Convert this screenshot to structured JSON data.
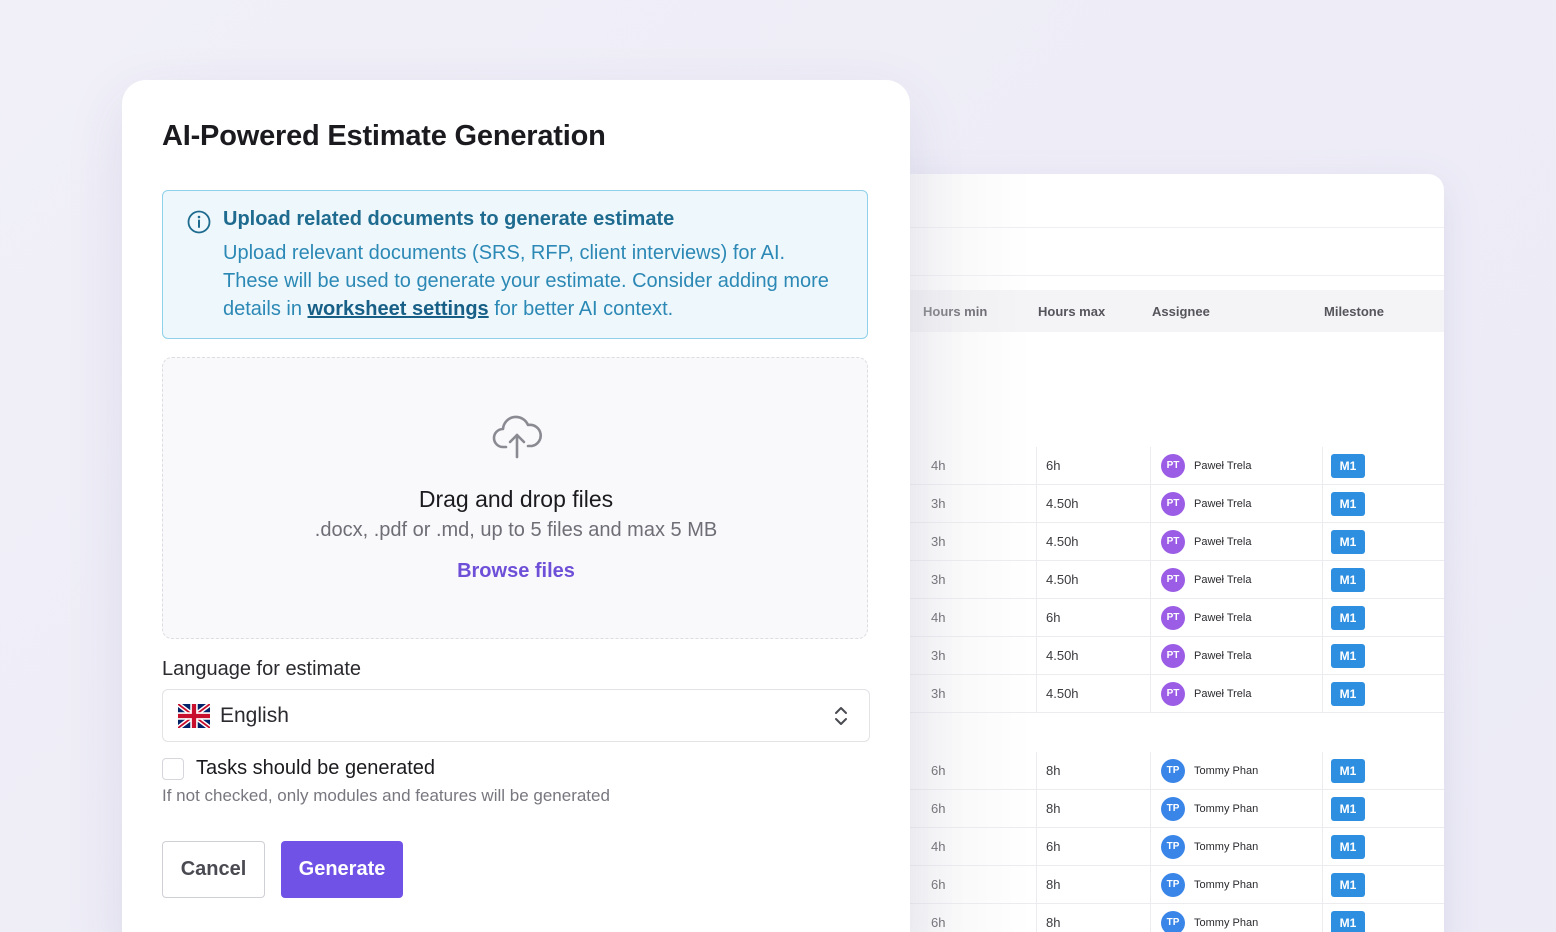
{
  "worksheet": {
    "columns": [
      "Hours min",
      "Hours max",
      "Assignee",
      "Milestone"
    ],
    "rows": [
      {
        "min": "4h",
        "max": "6h",
        "initials": "PT",
        "assignee": "Paweł Trela",
        "milestone": "M1",
        "color": "#9b5de5"
      },
      {
        "min": "3h",
        "max": "4.50h",
        "initials": "PT",
        "assignee": "Paweł Trela",
        "milestone": "M1",
        "color": "#9b5de5"
      },
      {
        "min": "3h",
        "max": "4.50h",
        "initials": "PT",
        "assignee": "Paweł Trela",
        "milestone": "M1",
        "color": "#9b5de5"
      },
      {
        "min": "3h",
        "max": "4.50h",
        "initials": "PT",
        "assignee": "Paweł Trela",
        "milestone": "M1",
        "color": "#9b5de5"
      },
      {
        "min": "4h",
        "max": "6h",
        "initials": "PT",
        "assignee": "Paweł Trela",
        "milestone": "M1",
        "color": "#9b5de5"
      },
      {
        "min": "3h",
        "max": "4.50h",
        "initials": "PT",
        "assignee": "Paweł Trela",
        "milestone": "M1",
        "color": "#9b5de5"
      },
      {
        "min": "3h",
        "max": "4.50h",
        "initials": "PT",
        "assignee": "Paweł Trela",
        "milestone": "M1",
        "color": "#9b5de5"
      },
      {
        "min": "6h",
        "max": "8h",
        "initials": "TP",
        "assignee": "Tommy Phan",
        "milestone": "M1",
        "color": "#3a86e8"
      },
      {
        "min": "6h",
        "max": "8h",
        "initials": "TP",
        "assignee": "Tommy Phan",
        "milestone": "M1",
        "color": "#3a86e8"
      },
      {
        "min": "4h",
        "max": "6h",
        "initials": "TP",
        "assignee": "Tommy Phan",
        "milestone": "M1",
        "color": "#3a86e8"
      },
      {
        "min": "6h",
        "max": "8h",
        "initials": "TP",
        "assignee": "Tommy Phan",
        "milestone": "M1",
        "color": "#3a86e8"
      },
      {
        "min": "6h",
        "max": "8h",
        "initials": "TP",
        "assignee": "Tommy Phan",
        "milestone": "M1",
        "color": "#3a86e8"
      }
    ]
  },
  "modal": {
    "title": "AI-Powered Estimate Generation",
    "info": {
      "title": "Upload related documents to generate estimate",
      "body_before": "Upload relevant documents (SRS, RFP, client interviews) for AI. These will be used to generate your estimate. Consider adding more details in ",
      "link": "worksheet settings",
      "body_after": " for better AI context."
    },
    "dropzone": {
      "title": "Drag and drop files",
      "subtitle": ".docx, .pdf or .md, up to 5 files and max 5 MB",
      "browse": "Browse files"
    },
    "language": {
      "label": "Language for estimate",
      "value": "English"
    },
    "tasks_checkbox": {
      "label": "Tasks should be generated",
      "help": "If not checked, only modules and features will be generated",
      "checked": false
    },
    "buttons": {
      "cancel": "Cancel",
      "generate": "Generate"
    }
  },
  "colors": {
    "accent": "#7152e6",
    "info_border": "#8fd0ea",
    "milestone": "#2e8fe0"
  }
}
